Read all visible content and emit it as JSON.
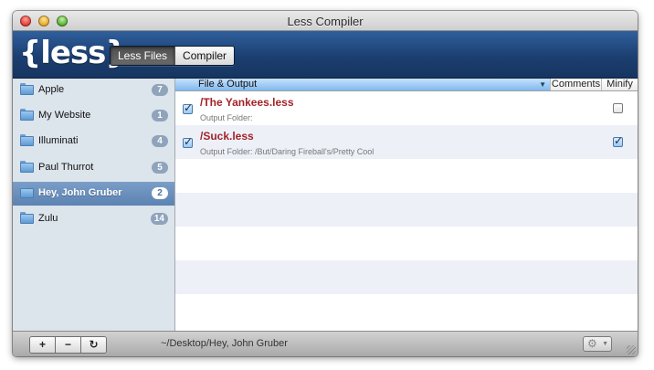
{
  "window": {
    "title": "Less Compiler"
  },
  "toolbar": {
    "logo_text": "{less}",
    "tabs": [
      {
        "label": "Less Files",
        "active": true
      },
      {
        "label": "Compiler",
        "active": false
      }
    ]
  },
  "sidebar": {
    "items": [
      {
        "label": "Apple",
        "count": "7",
        "selected": false
      },
      {
        "label": "My Website",
        "count": "1",
        "selected": false
      },
      {
        "label": "Illuminati",
        "count": "4",
        "selected": false
      },
      {
        "label": "Paul Thurrot",
        "count": "5",
        "selected": false
      },
      {
        "label": "Hey, John Gruber",
        "count": "2",
        "selected": true
      },
      {
        "label": "Zulu",
        "count": "14",
        "selected": false
      }
    ]
  },
  "list": {
    "columns": {
      "file": "File & Output",
      "comments": "Comments",
      "minify": "Minify"
    },
    "rows": [
      {
        "file": "/The Yankees.less",
        "output": "Output Folder:",
        "compile": true,
        "minify": false
      },
      {
        "file": "/Suck.less",
        "output": "Output Folder: /But/Daring Fireball's/Pretty Cool",
        "compile": true,
        "minify": true
      }
    ]
  },
  "bottombar": {
    "add_label": "+",
    "remove_label": "−",
    "refresh_label": "↻",
    "path": "~/Desktop/Hey, John Gruber",
    "gear_label": "⚙"
  },
  "colors": {
    "toolbar": "#1c3f71",
    "sidebar": "#dce4ec",
    "selection": "#5b82b2",
    "filename": "#a3232a"
  }
}
